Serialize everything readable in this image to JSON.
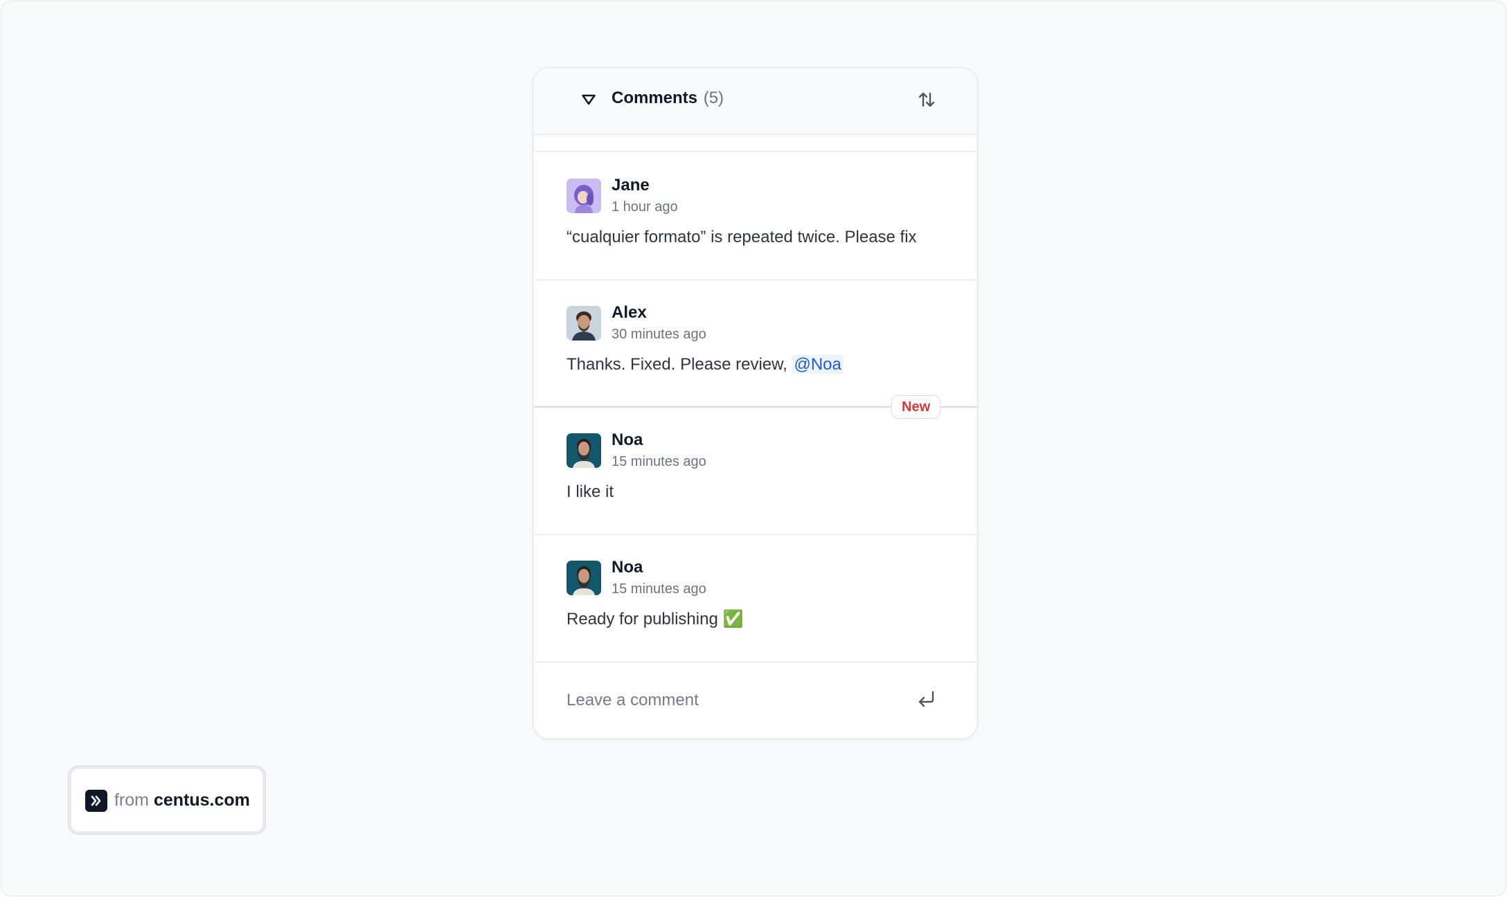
{
  "comments_panel": {
    "title": "Comments",
    "count": "(5)",
    "collapse_icon": "triangle-down-icon",
    "sort_icon": "sort-arrows-icon",
    "new_badge": "New",
    "comments": [
      {
        "author": "Jane",
        "time": "1 hour ago",
        "text": "“cualquier formato” is repeated twice. Please fix",
        "avatar": "jane-avatar"
      },
      {
        "author": "Alex",
        "time": "30 minutes ago",
        "text": "Thanks. Fixed. Please review, ",
        "mention": "@Noa",
        "avatar": "alex-avatar"
      },
      {
        "author": "Noa",
        "time": "15 minutes ago",
        "text": "I like it",
        "avatar": "noa-avatar"
      },
      {
        "author": "Noa",
        "time": "15 minutes ago",
        "text": "Ready for publishing ",
        "emoji": "✅",
        "avatar": "noa-avatar"
      }
    ],
    "input": {
      "placeholder": "Leave a comment",
      "value": ""
    },
    "send_icon": "enter-return-icon"
  },
  "brand": {
    "prefix": "from",
    "domain": "centus.com",
    "logo_icon": "double-chevron-right-icon"
  },
  "colors": {
    "page_background": "#f9fafb",
    "mention_blue": "#1d5fd1",
    "new_badge_red": "#d93636",
    "emoji_check_green": "#16a34a"
  }
}
